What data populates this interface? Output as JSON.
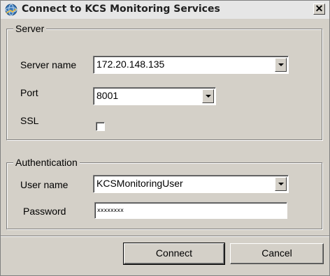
{
  "window": {
    "title": "Connect to KCS Monitoring Services",
    "close_glyph": "✕"
  },
  "server_group": {
    "legend": "Server",
    "server_name_label": "Server name",
    "server_name_value": "172.20.148.135",
    "port_label": "Port",
    "port_value": "8001",
    "ssl_label": "SSL",
    "ssl_checked": false
  },
  "auth_group": {
    "legend": "Authentication",
    "user_name_label": "User name",
    "user_name_value": "KCSMonitoringUser",
    "password_label": "Password",
    "password_value": "xxxxxxxx"
  },
  "buttons": {
    "connect_label": "Connect",
    "cancel_label": "Cancel"
  },
  "colors": {
    "dialog_bg": "#d4d0c8",
    "title_text": "#1f1f1f"
  },
  "icons": {
    "app_icon": "kcs-monitor-icon",
    "dropdown_icon": "chevron-down-icon"
  }
}
